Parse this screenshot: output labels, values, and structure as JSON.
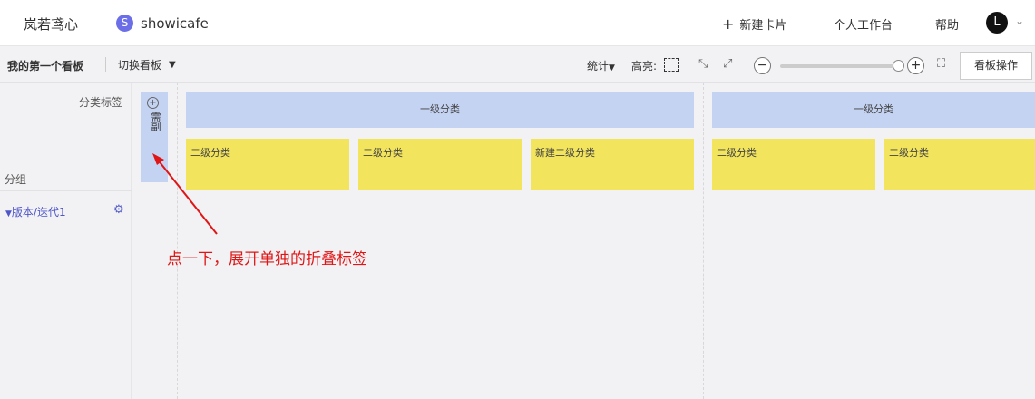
{
  "header": {
    "brand": "岚若鸢心",
    "project_initial": "S",
    "project_name": "showicafe",
    "new_card": "新建卡片",
    "workspace": "个人工作台",
    "help": "帮助",
    "avatar_initial": "L"
  },
  "toolbar": {
    "board_name": "我的第一个看板",
    "switch_board": "切换看板",
    "stats": "统计",
    "highlight": "高亮:",
    "zoom_out": "−",
    "zoom_in": "+",
    "board_actions": "看板操作"
  },
  "sidebar": {
    "category_label": "分类标签",
    "group_label": "分组",
    "group_item": "版本/迭代1"
  },
  "collapsed_column": {
    "text": "需副"
  },
  "board": {
    "level1": [
      "一级分类",
      "一级分类"
    ],
    "level2": [
      "二级分类",
      "二级分类",
      "新建二级分类",
      "二级分类",
      "二级分类"
    ]
  },
  "annotation": "点一下，展开单独的折叠标签",
  "colors": {
    "level1_bg": "#c5d3f3",
    "level2_bg": "#f2e45c",
    "annotation": "#e01515",
    "accent": "#6b6ee6"
  }
}
